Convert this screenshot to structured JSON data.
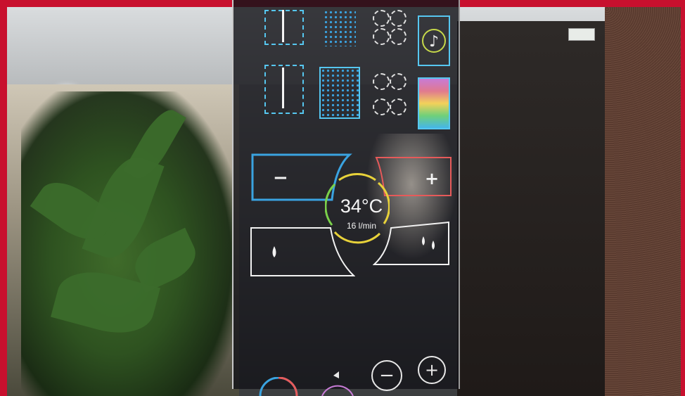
{
  "display": {
    "temperature": "34°C",
    "flow_rate": "16 l/min",
    "minus_symbol": "−",
    "plus_symbol": "+"
  },
  "colors": {
    "frame": "#c8102e",
    "panel_accent": "#56c7f0",
    "warm_accent": "#e65a5a",
    "ring_yellow": "#e8d23a",
    "ring_green": "#7ad04a"
  },
  "icons": [
    "single-jet-icon",
    "rain-shower-icon",
    "side-jets-icon",
    "music-icon",
    "single-jet-icon",
    "rain-shower-icon",
    "side-jets-icon",
    "light-color-icon",
    "water-drop-icon",
    "double-water-drop-icon",
    "temperature-ring-icon",
    "start-stop-icon",
    "cycle-icon"
  ]
}
